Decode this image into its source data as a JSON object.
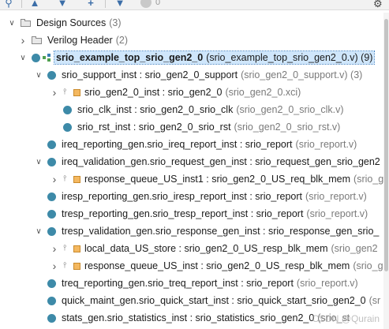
{
  "toolbar": {
    "icons": [
      "search-icon",
      "collapse-all-icon",
      "expand-all-icon",
      "add-sources-icon",
      "status-icon",
      "settings-icon"
    ],
    "badge_count": "0"
  },
  "tree": [
    {
      "name": "Design Sources",
      "meta": "(3)",
      "chev": "expanded",
      "icon": "folder"
    },
    {
      "name": "Verilog Header",
      "meta": "(2)",
      "chev": "collapsed",
      "icon": "folder"
    },
    {
      "name": "srio_example_top_srio_gen2_0",
      "meta": "(srio_example_top_srio_gen2_0.v) (9)",
      "chev": "expanded",
      "icon": "dot-hier",
      "selected": true
    },
    {
      "name": "srio_support_inst : srio_gen2_0_support",
      "meta": "(srio_gen2_0_support.v) (3)",
      "chev": "expanded",
      "icon": "dot"
    },
    {
      "name": "srio_gen2_0_inst : srio_gen2_0",
      "meta": "(srio_gen2_0.xci)",
      "chev": "collapsed",
      "icon": "ip"
    },
    {
      "name": "srio_clk_inst : srio_gen2_0_srio_clk",
      "meta": "(srio_gen2_0_srio_clk.v)",
      "chev": "none",
      "icon": "dot"
    },
    {
      "name": "srio_rst_inst : srio_gen2_0_srio_rst",
      "meta": "(srio_gen2_0_srio_rst.v)",
      "chev": "none",
      "icon": "dot"
    },
    {
      "name": "ireq_reporting_gen.srio_ireq_report_inst : srio_report",
      "meta": "(srio_report.v)",
      "chev": "none",
      "icon": "dot"
    },
    {
      "name": "ireq_validation_gen.srio_request_gen_inst : srio_request_gen_srio_gen2",
      "meta": "",
      "chev": "expanded",
      "icon": "dot"
    },
    {
      "name": "response_queue_US_inst1 : srio_gen2_0_US_req_blk_mem",
      "meta": "(srio_ge",
      "chev": "collapsed",
      "icon": "ip"
    },
    {
      "name": "iresp_reporting_gen.srio_iresp_report_inst : srio_report",
      "meta": "(srio_report.v)",
      "chev": "none",
      "icon": "dot"
    },
    {
      "name": "tresp_reporting_gen.srio_tresp_report_inst : srio_report",
      "meta": "(srio_report.v)",
      "chev": "none",
      "icon": "dot"
    },
    {
      "name": "tresp_validation_gen.srio_response_gen_inst : srio_response_gen_srio_",
      "meta": "",
      "chev": "expanded",
      "icon": "dot"
    },
    {
      "name": "local_data_US_store : srio_gen2_0_US_resp_blk_mem",
      "meta": "(srio_gen2",
      "chev": "collapsed",
      "icon": "ip"
    },
    {
      "name": "response_queue_US_inst : srio_gen2_0_US_resp_blk_mem",
      "meta": "(srio_ge",
      "chev": "collapsed",
      "icon": "ip"
    },
    {
      "name": "treq_reporting_gen.srio_treq_report_inst : srio_report",
      "meta": "(srio_report.v)",
      "chev": "none",
      "icon": "dot"
    },
    {
      "name": "quick_maint_gen.srio_quick_start_inst : srio_quick_start_srio_gen2_0",
      "meta": "(sr",
      "chev": "none",
      "icon": "dot"
    },
    {
      "name": "stats_gen.srio_statistics_inst : srio_statistics_srio_gen2_0",
      "meta": "(srio_st",
      "chev": "none",
      "icon": "dot"
    }
  ],
  "watermark": "CSDN @Qurain"
}
